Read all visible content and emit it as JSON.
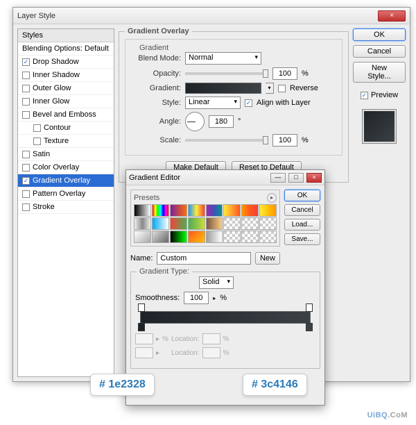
{
  "dialog": {
    "title": "Layer Style",
    "close": "×"
  },
  "styles": {
    "header": "Styles",
    "blending": "Blending Options: Default",
    "items": [
      {
        "label": "Drop Shadow",
        "checked": true
      },
      {
        "label": "Inner Shadow",
        "checked": false
      },
      {
        "label": "Outer Glow",
        "checked": false
      },
      {
        "label": "Inner Glow",
        "checked": false
      },
      {
        "label": "Bevel and Emboss",
        "checked": false
      },
      {
        "label": "Contour",
        "checked": false,
        "sub": true
      },
      {
        "label": "Texture",
        "checked": false,
        "sub": true
      },
      {
        "label": "Satin",
        "checked": false
      },
      {
        "label": "Color Overlay",
        "checked": false
      },
      {
        "label": "Gradient Overlay",
        "checked": true,
        "selected": true
      },
      {
        "label": "Pattern Overlay",
        "checked": false
      },
      {
        "label": "Stroke",
        "checked": false
      }
    ]
  },
  "gradient_overlay": {
    "legend": "Gradient Overlay",
    "sublegend": "Gradient",
    "blend_mode_label": "Blend Mode:",
    "blend_mode": "Normal",
    "opacity_label": "Opacity:",
    "opacity": "100",
    "pct": "%",
    "gradient_label": "Gradient:",
    "reverse_label": "Reverse",
    "style_label": "Style:",
    "style": "Linear",
    "align_label": "Align with Layer",
    "angle_label": "Angle:",
    "angle": "180",
    "deg": "°",
    "scale_label": "Scale:",
    "scale": "100",
    "make_default": "Make Default",
    "reset_default": "Reset to Default"
  },
  "right": {
    "ok": "OK",
    "cancel": "Cancel",
    "new_style": "New Style...",
    "preview": "Preview"
  },
  "ge": {
    "title": "Gradient Editor",
    "min": "—",
    "max": "□",
    "close": "×",
    "presets": "Presets",
    "ok": "OK",
    "cancel": "Cancel",
    "load": "Load...",
    "save": "Save...",
    "new": "New",
    "name_label": "Name:",
    "name": "Custom",
    "grad_type_label": "Gradient Type:",
    "grad_type": "Solid",
    "smoothness_label": "Smoothness:",
    "smoothness": "100",
    "pct": "%",
    "location_label": "Location:",
    "preset_gradients": [
      "linear-gradient(90deg,#000,#fff)",
      "linear-gradient(90deg,#f00,#ff0,#0f0,#0ff,#00f,#f0f,#f00)",
      "linear-gradient(90deg,#7b1fa2,#ff6f00)",
      "linear-gradient(90deg,#2196f3,#ffeb3b,#f44336)",
      "linear-gradient(90deg,#9c27b0,#3f51b5,#009688)",
      "linear-gradient(90deg,#ffeb3b,#ff5722)",
      "linear-gradient(90deg,#ff9800,#ff5722,#f44336)",
      "linear-gradient(90deg,#ffeb3b,#ffc107,#ff9800)",
      "linear-gradient(90deg,#eee,#888,#eee)",
      "linear-gradient(90deg,#03a9f4,#fff)",
      "linear-gradient(90deg,#f44336,#4caf50)",
      "linear-gradient(90deg,#4caf50,#8bc34a,#cddc39)",
      "linear-gradient(90deg,#795548,#ffcc80)",
      "repeating-conic-gradient(#ccc 0 25%,#fff 0 50%) 0/8px 8px",
      "repeating-conic-gradient(#ccc 0 25%,#fff 0 50%) 0/8px 8px",
      "repeating-conic-gradient(#ccc 0 25%,#fff 0 50%) 0/8px 8px",
      "linear-gradient(135deg,#fff,#aaa)",
      "linear-gradient(135deg,#ddd,#666)",
      "linear-gradient(90deg,#000,#0f0)",
      "linear-gradient(135deg,#ff5722,#ffc107)",
      "linear-gradient(90deg,#9e9e9e,#fff)",
      "repeating-conic-gradient(#ccc 0 25%,#fff 0 50%) 0/8px 8px",
      "repeating-conic-gradient(#ccc 0 25%,#fff 0 50%) 0/8px 8px",
      "repeating-conic-gradient(#ccc 0 25%,#fff 0 50%) 0/8px 8px"
    ]
  },
  "color_callouts": {
    "c1": "# 1e2328",
    "c2": "# 3c4146"
  },
  "watermark": {
    "a": "UiBQ",
    "b": ".CoM"
  }
}
